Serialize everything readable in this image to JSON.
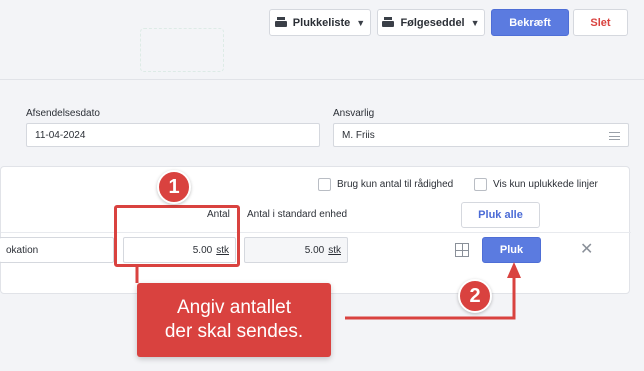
{
  "toolbar": {
    "picklist_label": "Plukkeliste",
    "delivery_note_label": "Følgeseddel",
    "confirm_label": "Bekræft",
    "delete_label": "Slet"
  },
  "form": {
    "ship_date_label": "Afsendelsesdato",
    "ship_date_value": "11-04-2024",
    "responsible_label": "Ansvarlig",
    "responsible_value": "M. Friis"
  },
  "lines": {
    "only_available_label": "Brug kun antal til rådighed",
    "show_unpicked_label": "Vis kun uplukkede linjer",
    "pick_all_label": "Pluk alle",
    "col_quantity": "Antal",
    "col_std_quantity": "Antal i standard enhed",
    "row": {
      "location_text": "okation",
      "quantity_value": "5.00",
      "quantity_unit": "stk",
      "std_quantity_value": "5.00",
      "std_quantity_unit": "stk",
      "pick_label": "Pluk"
    }
  },
  "annotations": {
    "step1": "1",
    "step2": "2",
    "callout_line1": "Angiv antallet",
    "callout_line2": "der skal sendes."
  },
  "colors": {
    "accent": "#5b7be0",
    "annotation_red": "#d9423f"
  }
}
